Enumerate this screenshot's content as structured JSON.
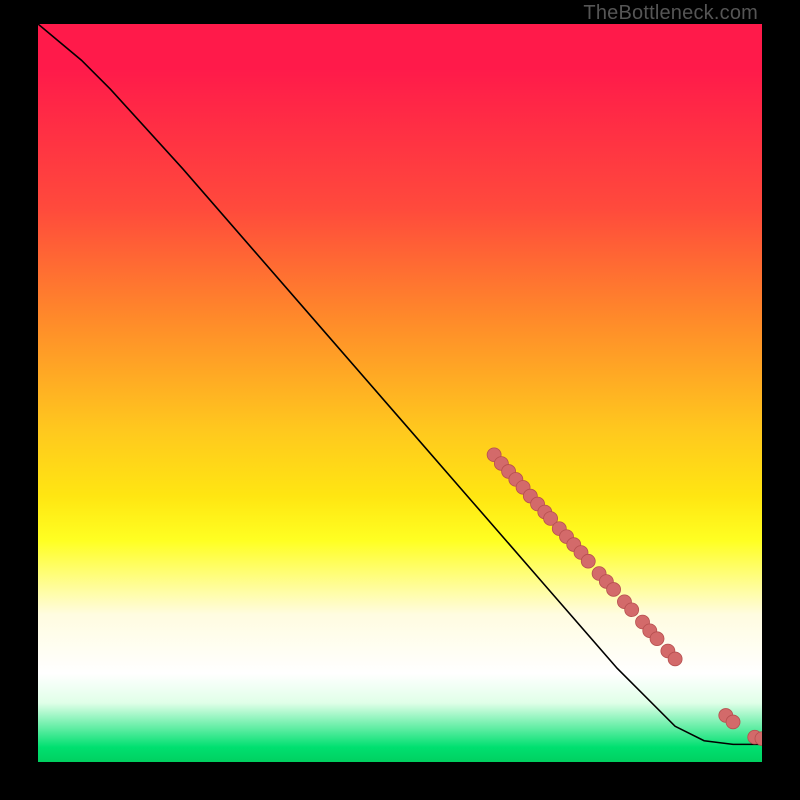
{
  "watermark": "TheBottleneck.com",
  "chart_data": {
    "type": "line",
    "title": "",
    "xlabel": "",
    "ylabel": "",
    "xlim": [
      0,
      100
    ],
    "ylim": [
      0,
      100
    ],
    "grid": false,
    "legend": false,
    "annotations": [],
    "curve": [
      {
        "x": 0,
        "y": 100
      },
      {
        "x": 3,
        "y": 97.5
      },
      {
        "x": 6,
        "y": 95
      },
      {
        "x": 10,
        "y": 91
      },
      {
        "x": 20,
        "y": 80
      },
      {
        "x": 30,
        "y": 68.5
      },
      {
        "x": 40,
        "y": 57
      },
      {
        "x": 50,
        "y": 45.5
      },
      {
        "x": 60,
        "y": 34
      },
      {
        "x": 70,
        "y": 22.5
      },
      {
        "x": 80,
        "y": 11
      },
      {
        "x": 88,
        "y": 3
      },
      {
        "x": 92,
        "y": 1
      },
      {
        "x": 96,
        "y": 0.5
      },
      {
        "x": 100,
        "y": 0.5
      }
    ],
    "points": [
      {
        "x": 63,
        "y": 40.5
      },
      {
        "x": 64,
        "y": 39.3
      },
      {
        "x": 65,
        "y": 38.2
      },
      {
        "x": 66,
        "y": 37.1
      },
      {
        "x": 67,
        "y": 36.0
      },
      {
        "x": 68,
        "y": 34.8
      },
      {
        "x": 69,
        "y": 33.7
      },
      {
        "x": 70,
        "y": 32.6
      },
      {
        "x": 70.8,
        "y": 31.7
      },
      {
        "x": 72,
        "y": 30.3
      },
      {
        "x": 73,
        "y": 29.2
      },
      {
        "x": 74,
        "y": 28.1
      },
      {
        "x": 75,
        "y": 27.0
      },
      {
        "x": 76,
        "y": 25.8
      },
      {
        "x": 77.5,
        "y": 24.1
      },
      {
        "x": 78.5,
        "y": 23.0
      },
      {
        "x": 79.5,
        "y": 21.9
      },
      {
        "x": 81,
        "y": 20.2
      },
      {
        "x": 82,
        "y": 19.1
      },
      {
        "x": 83.5,
        "y": 17.4
      },
      {
        "x": 84.5,
        "y": 16.2
      },
      {
        "x": 85.5,
        "y": 15.1
      },
      {
        "x": 87,
        "y": 13.4
      },
      {
        "x": 88,
        "y": 12.3
      },
      {
        "x": 95,
        "y": 4.5
      },
      {
        "x": 96,
        "y": 3.6
      },
      {
        "x": 99,
        "y": 1.5
      },
      {
        "x": 100,
        "y": 1.3
      }
    ],
    "colors": {
      "line": "#000000",
      "point_fill": "#d36a6a",
      "point_stroke": "#b64f4f"
    }
  }
}
